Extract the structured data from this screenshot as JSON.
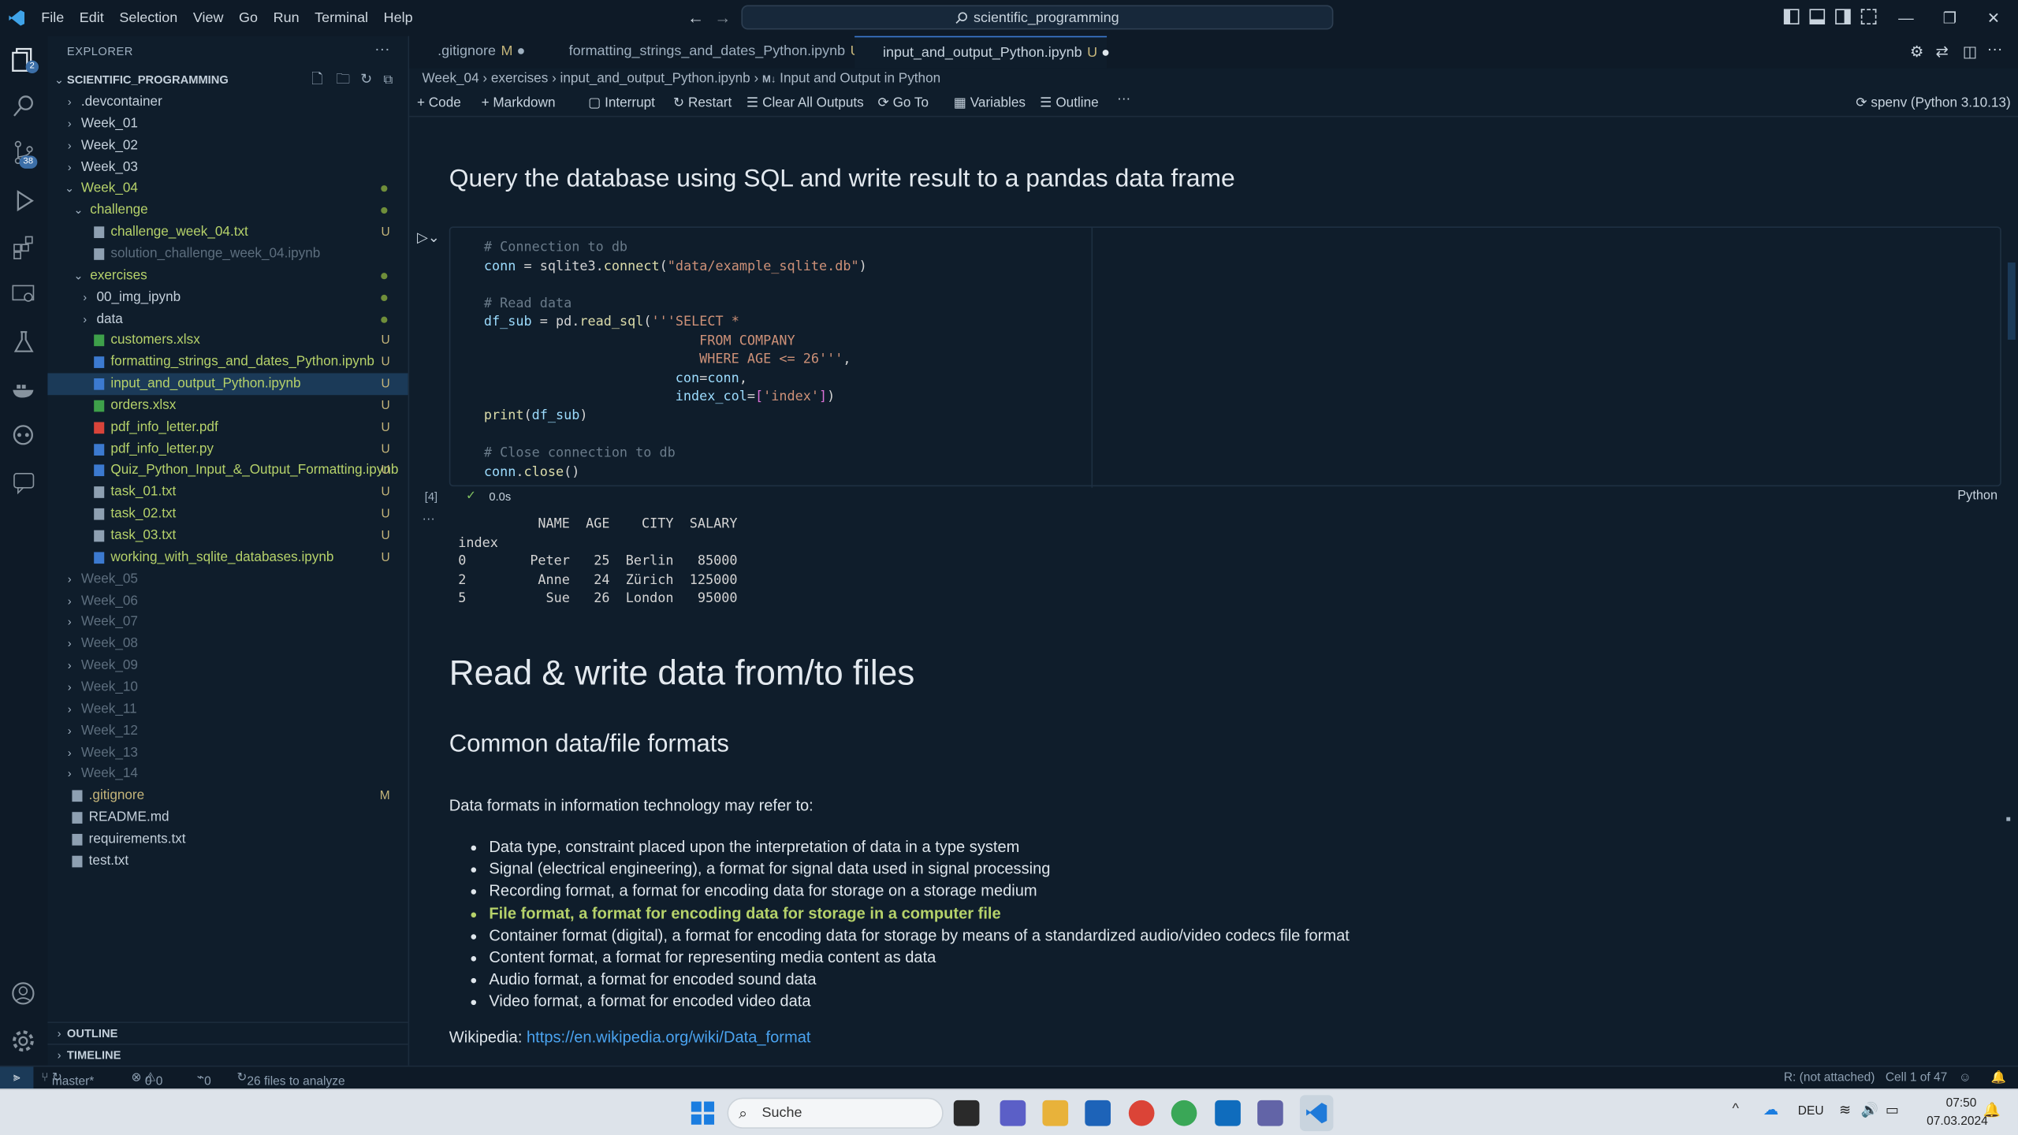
{
  "menu": [
    "File",
    "Edit",
    "Selection",
    "View",
    "Go",
    "Run",
    "Terminal",
    "Help"
  ],
  "search_box": "scientific_programming",
  "explorer": {
    "title": "EXPLORER",
    "root": "SCIENTIFIC_PROGRAMMING",
    "items": [
      ".devcontainer",
      "Week_01",
      "Week_02",
      "Week_03",
      "Week_04",
      "challenge",
      "challenge_week_04.txt",
      "solution_challenge_week_04.ipynb",
      "exercises",
      "00_img_ipynb",
      "data",
      "customers.xlsx",
      "formatting_strings_and_dates_Python.ipynb",
      "input_and_output_Python.ipynb",
      "orders.xlsx",
      "pdf_info_letter.pdf",
      "pdf_info_letter.py",
      "Quiz_Python_Input_&_Output_Formatting.ipynb",
      "task_01.txt",
      "task_02.txt",
      "task_03.txt",
      "working_with_sqlite_databases.ipynb",
      "Week_05",
      "Week_06",
      "Week_07",
      "Week_08",
      "Week_09",
      "Week_10",
      "Week_11",
      "Week_12",
      "Week_13",
      "Week_14",
      ".gitignore",
      "README.md",
      "requirements.txt",
      "test.txt"
    ],
    "status": {
      "u": "U",
      "m": "M"
    },
    "outline": "OUTLINE",
    "timeline": "TIMELINE"
  },
  "badges": {
    "scm": "2",
    "ext": "38"
  },
  "tabs": [
    {
      "label": ".gitignore",
      "mark": "M"
    },
    {
      "label": "formatting_strings_and_dates_Python.ipynb",
      "mark": "U"
    },
    {
      "label": "input_and_output_Python.ipynb",
      "mark": "U"
    }
  ],
  "breadcrumb": [
    "Week_04",
    "exercises",
    "input_and_output_Python.ipynb",
    "Input and Output in Python"
  ],
  "toolbar": {
    "code": "Code",
    "markdown": "Markdown",
    "interrupt": "Interrupt",
    "restart": "Restart",
    "clear": "Clear All Outputs",
    "goto": "Go To",
    "variables": "Variables",
    "outline": "Outline",
    "kernel": "spenv (Python 3.10.13)"
  },
  "notebook": {
    "heading1": "Query the database using SQL and write result to a pandas data frame",
    "exec_count": "[4]",
    "exec_time": "0.0s",
    "language": "Python",
    "table": {
      "header": [
        "NAME",
        "AGE",
        "CITY",
        "SALARY"
      ],
      "index_label": "index",
      "rows": [
        [
          "0",
          "Peter",
          "25",
          "Berlin",
          "85000"
        ],
        [
          "2",
          "Anne",
          "24",
          "Zürich",
          "125000"
        ],
        [
          "5",
          "Sue",
          "26",
          "London",
          "95000"
        ]
      ]
    },
    "heading2": "Read & write data from/to files",
    "heading3": "Common data/file formats",
    "intro": "Data formats in information technology may refer to:",
    "bullets": [
      "Data type, constraint placed upon the interpretation of data in a type system",
      "Signal (electrical engineering), a format for signal data used in signal processing",
      "Recording format, a format for encoding data for storage on a storage medium",
      "File format, a format for encoding data for storage in a computer file",
      "Container format (digital), a format for encoding data for storage by means of a standardized audio/video codecs file format",
      "Content format, a format for representing media content as data",
      "Audio format, a format for encoded sound data",
      "Video format, a format for encoded video data"
    ],
    "wiki_label": "Wikipedia:",
    "wiki_link": "https://en.wikipedia.org/wiki/Data_format"
  },
  "statusbar": {
    "branch": "master*",
    "errors": "0",
    "warnings": "0",
    "ports": "0",
    "analyze": "26 files to analyze",
    "attached": "R: (not attached)",
    "cell": "Cell 1 of 47"
  },
  "taskbar": {
    "search": "Suche",
    "lang": "DEU",
    "time": "07:50",
    "date": "07.03.2024"
  },
  "colors": {
    "accent": "#3c7ad0",
    "highlight": "#b6d26a",
    "link": "#4aa3f0"
  }
}
